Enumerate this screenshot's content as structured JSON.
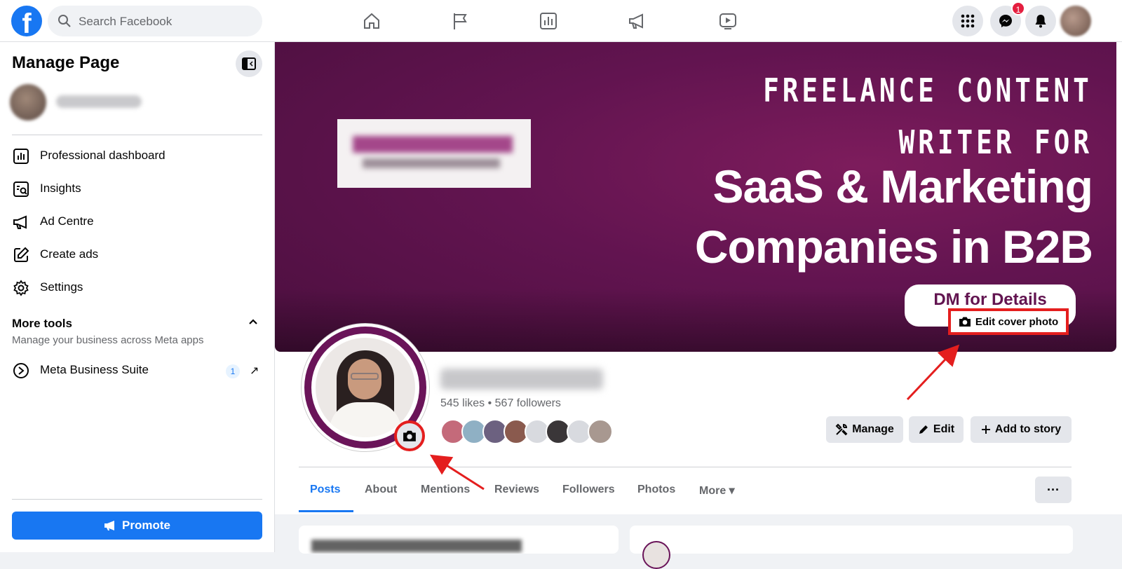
{
  "topbar": {
    "logo_letter": "f",
    "search_placeholder": "Search Facebook",
    "messenger_badge": "1"
  },
  "sidebar": {
    "title": "Manage Page",
    "items": [
      {
        "label": "Professional dashboard",
        "icon": "dashboard-icon"
      },
      {
        "label": "Insights",
        "icon": "insights-icon"
      },
      {
        "label": "Ad Centre",
        "icon": "megaphone-icon"
      },
      {
        "label": "Create ads",
        "icon": "pencil-square-icon"
      },
      {
        "label": "Settings",
        "icon": "gear-icon"
      }
    ],
    "more_tools_title": "More tools",
    "more_tools_subtitle": "Manage your business across Meta apps",
    "meta_business_suite": {
      "label": "Meta Business Suite",
      "count": "1",
      "arrow": "↗"
    },
    "promote_label": "Promote"
  },
  "cover": {
    "line1": "FREELANCE CONTENT",
    "line2": "WRITER FOR",
    "line3": "SaaS & Marketing",
    "line4": "Companies in B2B",
    "cta": "DM for Details",
    "edit_cover_label": "Edit cover photo",
    "colors": {
      "background": "#621450",
      "highlight": "#e41e1e"
    }
  },
  "profile": {
    "stats": "545 likes • 567 followers",
    "actions": {
      "manage": "Manage",
      "edit": "Edit",
      "add_story": "Add to story"
    }
  },
  "tabs": [
    {
      "label": "Posts",
      "active": true
    },
    {
      "label": "About"
    },
    {
      "label": "Mentions"
    },
    {
      "label": "Reviews"
    },
    {
      "label": "Followers"
    },
    {
      "label": "Photos"
    },
    {
      "label": "More ▾"
    }
  ],
  "tab_more_button": "···"
}
